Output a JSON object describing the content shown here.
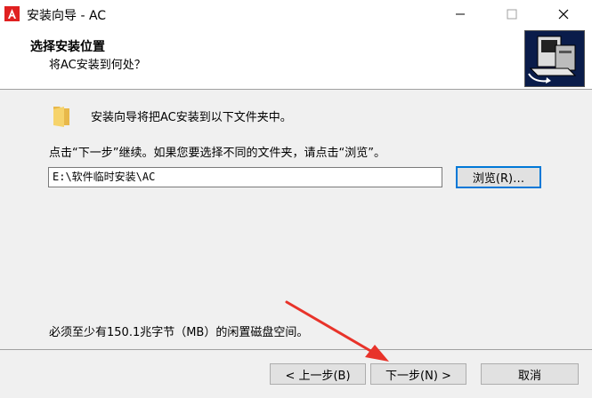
{
  "window": {
    "title": "安装向导 - AC",
    "accent_color": "#e02020"
  },
  "header": {
    "title": "选择安装位置",
    "subtitle": "将AC安装到何处？"
  },
  "body": {
    "info": "安装向导将把AC安装到以下文件夹中。",
    "instruction": "点击“下一步”继续。如果您要选择不同的文件夹，请点击“浏览”。",
    "path_value": "E:\\软件临时安装\\AC",
    "browse_label": "浏览(R)…",
    "space_note": "必须至少有150.1兆字节（MB）的闲置磁盘空间。"
  },
  "footer": {
    "back_label": "< 上一步(B)",
    "next_label": "下一步(N) >",
    "cancel_label": "取消"
  },
  "annotation": {
    "arrow_color": "#e8332a"
  }
}
